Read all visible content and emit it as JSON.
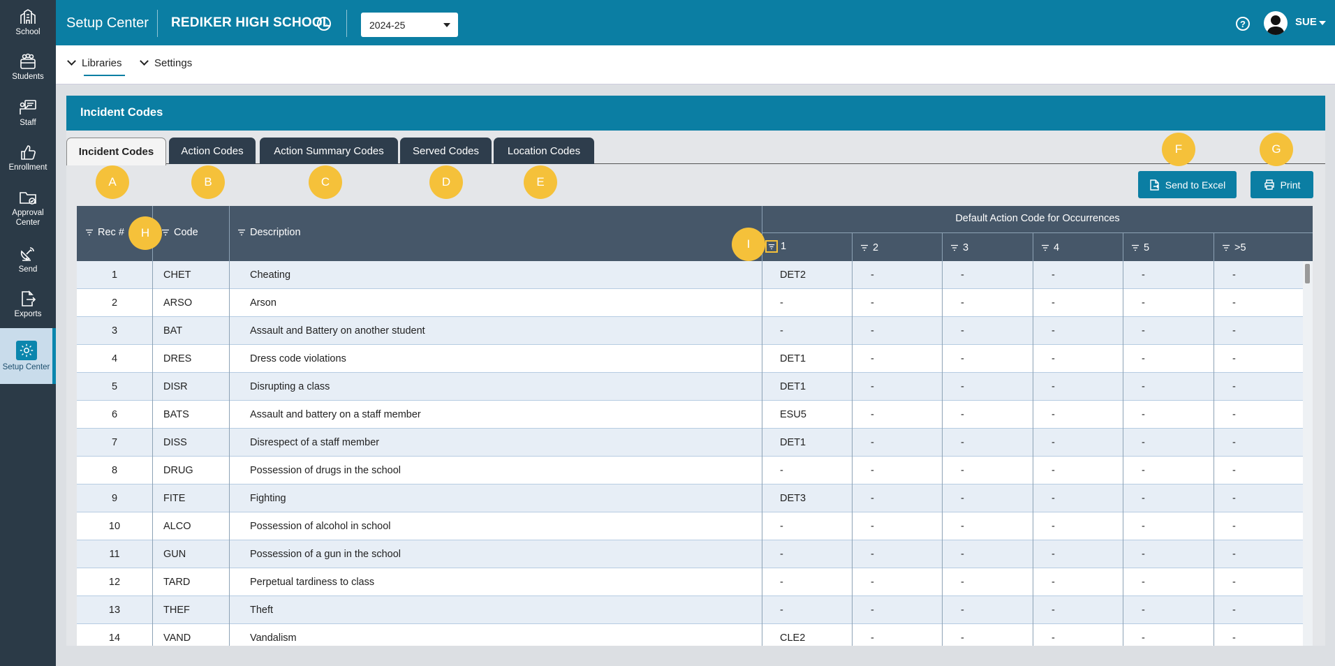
{
  "rail": [
    {
      "label": "School",
      "icon": "school-icon"
    },
    {
      "label": "Students",
      "icon": "students-icon"
    },
    {
      "label": "Staff",
      "icon": "staff-icon"
    },
    {
      "label": "Enrollment",
      "icon": "thumbs-up-icon"
    },
    {
      "label": "Approval Center",
      "icon": "folder-check-icon"
    },
    {
      "label": "Send",
      "icon": "satellite-icon"
    },
    {
      "label": "Exports",
      "icon": "export-icon"
    },
    {
      "label": "Setup Center",
      "icon": "gear-icon"
    }
  ],
  "topbar": {
    "app_title": "Setup Center",
    "school": "REDIKER HIGH SCHOOL",
    "year": "2024-25",
    "user": "SUE"
  },
  "subnav": {
    "libraries": "Libraries",
    "settings": "Settings"
  },
  "panel": {
    "title": "Incident Codes",
    "tabs": [
      "Incident Codes",
      "Action Codes",
      "Action Summary Codes",
      "Served Codes",
      "Location Codes"
    ],
    "send_excel": "Send to Excel",
    "print": "Print"
  },
  "callouts": [
    "A",
    "B",
    "C",
    "D",
    "E",
    "F",
    "G",
    "H",
    "I"
  ],
  "table": {
    "headers": {
      "rec": "Rec #",
      "code": "Code",
      "desc": "Description",
      "group": "Default Action Code for Occurrences"
    },
    "occ": [
      "1",
      "2",
      "3",
      "4",
      "5",
      ">5"
    ],
    "rows": [
      {
        "rec": "1",
        "code": "CHET",
        "desc": "Cheating",
        "o1": "DET2",
        "o2": "-",
        "o3": "-",
        "o4": "-",
        "o5": "-",
        "o6": "-"
      },
      {
        "rec": "2",
        "code": "ARSO",
        "desc": "Arson",
        "o1": "-",
        "o2": "-",
        "o3": "-",
        "o4": "-",
        "o5": "-",
        "o6": "-"
      },
      {
        "rec": "3",
        "code": "BAT",
        "desc": "Assault and Battery on another student",
        "o1": "-",
        "o2": "-",
        "o3": "-",
        "o4": "-",
        "o5": "-",
        "o6": "-"
      },
      {
        "rec": "4",
        "code": "DRES",
        "desc": "Dress code violations",
        "o1": "DET1",
        "o2": "-",
        "o3": "-",
        "o4": "-",
        "o5": "-",
        "o6": "-"
      },
      {
        "rec": "5",
        "code": "DISR",
        "desc": "Disrupting a class",
        "o1": "DET1",
        "o2": "-",
        "o3": "-",
        "o4": "-",
        "o5": "-",
        "o6": "-"
      },
      {
        "rec": "6",
        "code": "BATS",
        "desc": "Assault and battery on a staff member",
        "o1": "ESU5",
        "o2": "-",
        "o3": "-",
        "o4": "-",
        "o5": "-",
        "o6": "-"
      },
      {
        "rec": "7",
        "code": "DISS",
        "desc": "Disrespect of a staff member",
        "o1": "DET1",
        "o2": "-",
        "o3": "-",
        "o4": "-",
        "o5": "-",
        "o6": "-"
      },
      {
        "rec": "8",
        "code": "DRUG",
        "desc": "Possession of drugs in the school",
        "o1": "-",
        "o2": "-",
        "o3": "-",
        "o4": "-",
        "o5": "-",
        "o6": "-"
      },
      {
        "rec": "9",
        "code": "FITE",
        "desc": "Fighting",
        "o1": "DET3",
        "o2": "-",
        "o3": "-",
        "o4": "-",
        "o5": "-",
        "o6": "-"
      },
      {
        "rec": "10",
        "code": "ALCO",
        "desc": "Possession of alcohol in school",
        "o1": "-",
        "o2": "-",
        "o3": "-",
        "o4": "-",
        "o5": "-",
        "o6": "-"
      },
      {
        "rec": "11",
        "code": "GUN",
        "desc": "Possession of a gun in the school",
        "o1": "-",
        "o2": "-",
        "o3": "-",
        "o4": "-",
        "o5": "-",
        "o6": "-"
      },
      {
        "rec": "12",
        "code": "TARD",
        "desc": "Perpetual tardiness to class",
        "o1": "-",
        "o2": "-",
        "o3": "-",
        "o4": "-",
        "o5": "-",
        "o6": "-"
      },
      {
        "rec": "13",
        "code": "THEF",
        "desc": "Theft",
        "o1": "-",
        "o2": "-",
        "o3": "-",
        "o4": "-",
        "o5": "-",
        "o6": "-"
      },
      {
        "rec": "14",
        "code": "VAND",
        "desc": "Vandalism",
        "o1": "CLE2",
        "o2": "-",
        "o3": "-",
        "o4": "-",
        "o5": "-",
        "o6": "-"
      }
    ]
  },
  "colors": {
    "brand": "#0b7ea3",
    "rail": "#2b3a47",
    "tab": "#2e3d4c",
    "header": "#465769",
    "callout": "#f5c13a",
    "alt_row": "#e7eef6"
  }
}
